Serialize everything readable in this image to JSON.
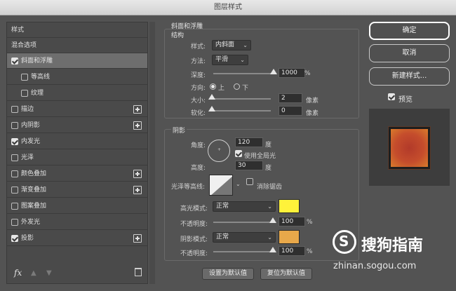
{
  "window_title": "图层样式",
  "left": {
    "header": "样式",
    "blend": "混合选项",
    "items": [
      {
        "label": "斜面和浮雕",
        "checked": true,
        "plus": false
      },
      {
        "label": "等高线",
        "checked": false,
        "plus": false
      },
      {
        "label": "纹理",
        "checked": false,
        "plus": false
      },
      {
        "label": "描边",
        "checked": false,
        "plus": true
      },
      {
        "label": "内阴影",
        "checked": false,
        "plus": true
      },
      {
        "label": "内发光",
        "checked": true,
        "plus": false
      },
      {
        "label": "光泽",
        "checked": false,
        "plus": false
      },
      {
        "label": "颜色叠加",
        "checked": false,
        "plus": true
      },
      {
        "label": "渐变叠加",
        "checked": false,
        "plus": true
      },
      {
        "label": "图案叠加",
        "checked": false,
        "plus": false
      },
      {
        "label": "外发光",
        "checked": false,
        "plus": false
      },
      {
        "label": "投影",
        "checked": true,
        "plus": true
      }
    ],
    "fx": "fx"
  },
  "bevel": {
    "section_title": "斜面和浮雕",
    "structure_title": "结构",
    "style_label": "样式:",
    "style_value": "内斜面",
    "method_label": "方法:",
    "method_value": "平滑",
    "depth_label": "深度:",
    "depth_value": "1000",
    "depth_unit": "%",
    "depth_level": 1.0,
    "direction_label": "方向:",
    "direction_up": "上",
    "direction_down": "下",
    "size_label": "大小:",
    "size_value": "2",
    "size_unit": "像素",
    "soften_label": "软化:",
    "soften_value": "0",
    "soften_unit": "像素"
  },
  "shading": {
    "title": "阴影",
    "angle_label": "角度:",
    "angle_value": "120",
    "angle_unit": "度",
    "global_light": "使用全局光",
    "altitude_label": "高度:",
    "altitude_value": "30",
    "altitude_unit": "度",
    "gloss_label": "光泽等高线:",
    "antialias": "消除锯齿",
    "highlight_label": "高光模式:",
    "highlight_mode": "正常",
    "highlight_color": "#fff23a",
    "highlight_opacity_label": "不透明度:",
    "highlight_opacity": "100",
    "shadow_label": "阴影模式:",
    "shadow_mode": "正常",
    "shadow_color": "#e8a84a",
    "shadow_opacity_label": "不透明度:",
    "shadow_opacity": "100",
    "percent": "%"
  },
  "footer": {
    "make_default": "设置为默认值",
    "reset_default": "复位为默认值"
  },
  "right": {
    "ok": "确定",
    "cancel": "取消",
    "new_style": "新建样式...",
    "preview": "预览"
  },
  "watermark": {
    "brand": "搜狗指南",
    "url": "zhinan.sogou.com"
  }
}
